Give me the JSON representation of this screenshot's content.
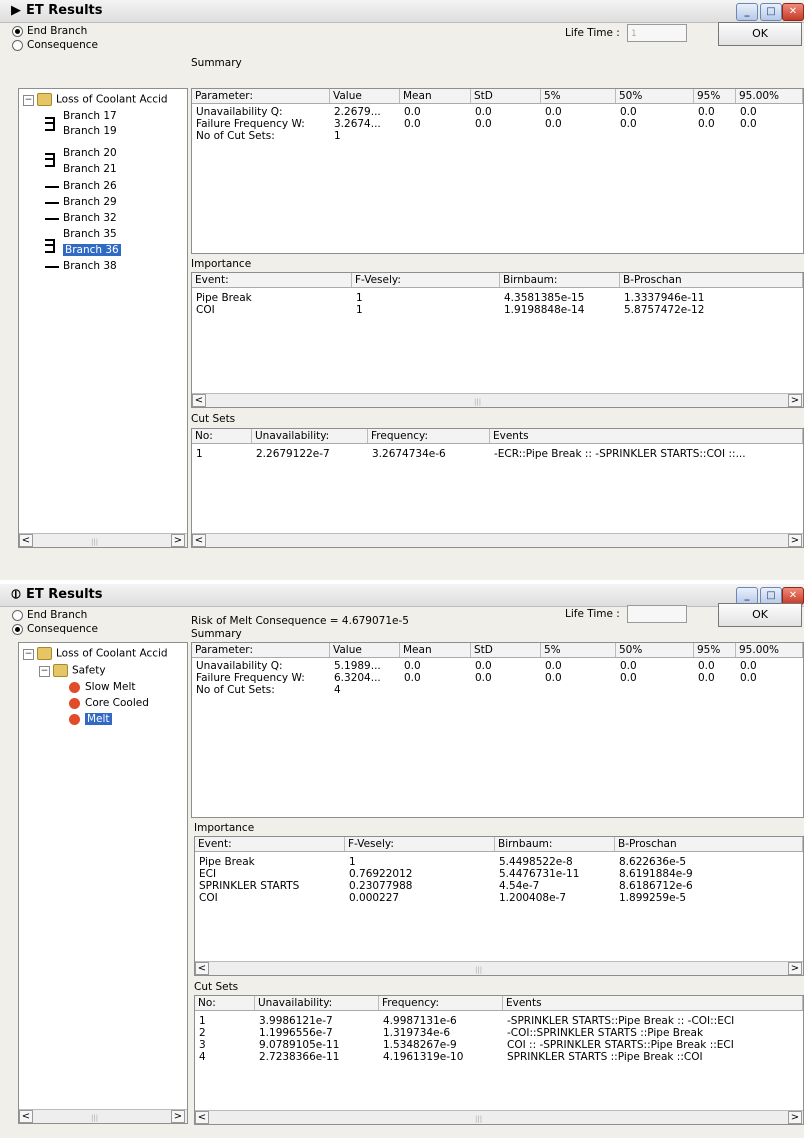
{
  "window1": {
    "title": "ET Results",
    "radio_end_branch": "End Branch",
    "radio_consequence": "Consequence",
    "risk_text": "",
    "life_time_label": "Life Time :",
    "life_time_value": "1",
    "ok_label": "OK",
    "tree": {
      "root": "Loss of Coolant Accid",
      "items": [
        "Branch 17",
        "Branch 19",
        "Branch 20",
        "Branch 21",
        "Branch 26",
        "Branch 29",
        "Branch 32",
        "Branch 35",
        "Branch 36",
        "Branch 38"
      ]
    },
    "summary_title": "Summary",
    "summary_headers": [
      "Parameter:",
      "Value",
      "Mean",
      "StD",
      "5%",
      "50%",
      "95%",
      "95.00%"
    ],
    "summary_rows": [
      [
        "Unavailability Q:",
        "2.2679...",
        "0.0",
        "0.0",
        "0.0",
        "0.0",
        "0.0",
        "0.0"
      ],
      [
        "Failure Frequency W:",
        "3.2674...",
        "0.0",
        "0.0",
        "0.0",
        "0.0",
        "0.0",
        "0.0"
      ],
      [
        "No of Cut Sets:",
        "1",
        "",
        "",
        "",
        "",
        "",
        ""
      ]
    ],
    "importance_title": "Importance",
    "importance_headers": [
      "Event:",
      "F-Vesely:",
      "Birnbaum:",
      "B-Proschan"
    ],
    "importance_rows": [
      [
        "Pipe Break",
        "1",
        "4.3581385e-15",
        "1.3337946e-11"
      ],
      [
        "COI",
        "1",
        "1.9198848e-14",
        "5.8757472e-12"
      ]
    ],
    "cutsets_title": "Cut Sets",
    "cutsets_headers": [
      "No:",
      "Unavailability:",
      "Frequency:",
      "Events"
    ],
    "cutsets_rows": [
      [
        "1",
        "2.2679122e-7",
        "3.2674734e-6",
        "-ECR::Pipe Break :: -SPRINKLER STARTS::COI ::..."
      ]
    ]
  },
  "window2": {
    "title": "ET Results",
    "radio_end_branch": "End Branch",
    "radio_consequence": "Consequence",
    "risk_text": "Risk of Melt Consequence = 4.679071e-5",
    "life_time_label": "Life Time :",
    "life_time_value": "",
    "ok_label": "OK",
    "tree": {
      "root": "Loss of Coolant Accid",
      "safety": "Safety",
      "items": [
        "Slow Melt",
        "Core Cooled",
        "Melt"
      ]
    },
    "summary_title": "Summary",
    "summary_headers": [
      "Parameter:",
      "Value",
      "Mean",
      "StD",
      "5%",
      "50%",
      "95%",
      "95.00%"
    ],
    "summary_rows": [
      [
        "Unavailability Q:",
        "5.1989...",
        "0.0",
        "0.0",
        "0.0",
        "0.0",
        "0.0",
        "0.0"
      ],
      [
        "Failure Frequency W:",
        "6.3204...",
        "0.0",
        "0.0",
        "0.0",
        "0.0",
        "0.0",
        "0.0"
      ],
      [
        "No of Cut Sets:",
        "4",
        "",
        "",
        "",
        "",
        "",
        ""
      ]
    ],
    "importance_title": "Importance",
    "importance_headers": [
      "Event:",
      "F-Vesely:",
      "Birnbaum:",
      "B-Proschan"
    ],
    "importance_rows": [
      [
        "Pipe Break",
        "1",
        "5.4498522e-8",
        "8.622636e-5"
      ],
      [
        "ECI",
        "0.76922012",
        "5.4476731e-11",
        "8.6191884e-9"
      ],
      [
        "SPRINKLER STARTS",
        "0.23077988",
        "4.54e-7",
        "8.6186712e-6"
      ],
      [
        "COI",
        "0.000227",
        "1.200408e-7",
        "1.899259e-5"
      ]
    ],
    "cutsets_title": "Cut Sets",
    "cutsets_headers": [
      "No:",
      "Unavailability:",
      "Frequency:",
      "Events"
    ],
    "cutsets_rows": [
      [
        "1",
        "3.9986121e-7",
        "4.9987131e-6",
        "-SPRINKLER STARTS::Pipe Break :: -COI::ECI"
      ],
      [
        "2",
        "1.1996556e-7",
        "1.319734e-6",
        "-COI::SPRINKLER STARTS ::Pipe Break"
      ],
      [
        "3",
        "9.0789105e-11",
        "1.5348267e-9",
        "COI :: -SPRINKLER STARTS::Pipe Break ::ECI"
      ],
      [
        "4",
        "2.7238366e-11",
        "4.1961319e-10",
        "SPRINKLER STARTS ::Pipe Break ::COI"
      ]
    ]
  }
}
